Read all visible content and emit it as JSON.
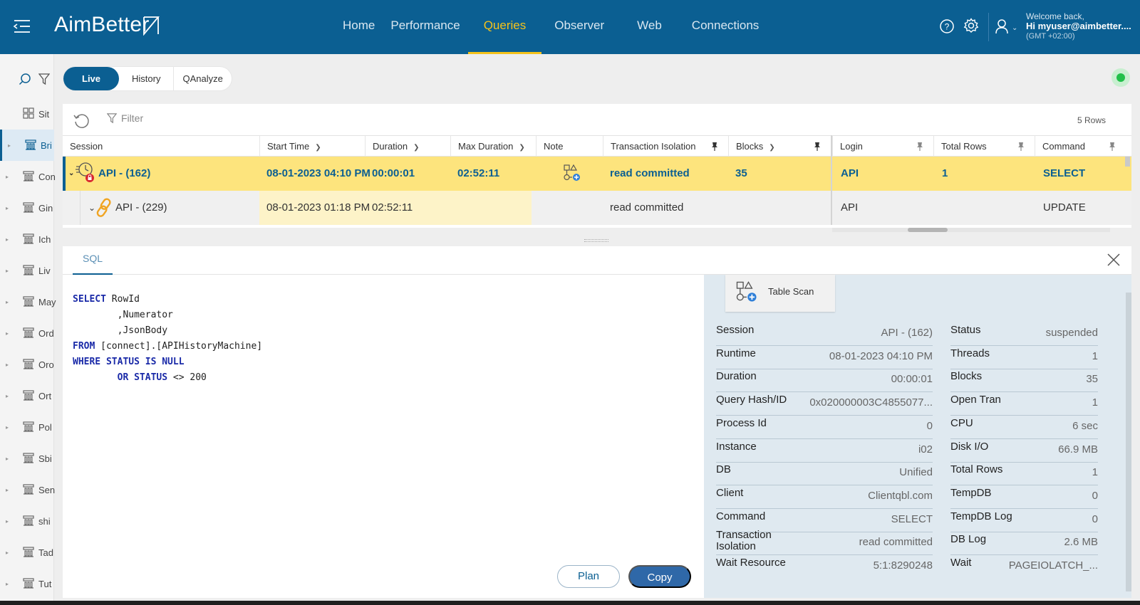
{
  "app": {
    "logo": "AimBetter"
  },
  "nav": {
    "items": [
      {
        "label": "Home"
      },
      {
        "label": "Performance"
      },
      {
        "label": "Queries",
        "active": true
      },
      {
        "label": "Observer"
      },
      {
        "label": "Web"
      },
      {
        "label": "Connections"
      }
    ]
  },
  "user": {
    "welcome": "Welcome back,",
    "hi": "Hi myuser@aimbetter....",
    "timezone": "(GMT +02:00)"
  },
  "sidebar": {
    "items": [
      {
        "label": "Sit"
      },
      {
        "label": "Bri",
        "active": true
      },
      {
        "label": "Con"
      },
      {
        "label": "Gin"
      },
      {
        "label": "Ich"
      },
      {
        "label": "Liv"
      },
      {
        "label": "May"
      },
      {
        "label": "Ord"
      },
      {
        "label": "Oro"
      },
      {
        "label": "Ort"
      },
      {
        "label": "Pol"
      },
      {
        "label": "Sbi"
      },
      {
        "label": "Sen"
      },
      {
        "label": "shi"
      },
      {
        "label": "Tad"
      },
      {
        "label": "Tut"
      }
    ]
  },
  "view_tabs": {
    "live": "Live",
    "history": "History",
    "qanalyze": "QAnalyze"
  },
  "grid": {
    "filter_label": "Filter",
    "rows_count": "5 Rows",
    "columns": {
      "session": "Session",
      "start_time": "Start Time",
      "duration": "Duration",
      "max_duration": "Max Duration",
      "note": "Note",
      "transaction_isolation": "Transaction Isolation",
      "blocks": "Blocks",
      "login": "Login",
      "total_rows": "Total Rows",
      "command": "Command"
    },
    "rows": [
      {
        "session": "API - (162)",
        "start_time": "08-01-2023 04:10 PM",
        "duration": "00:00:01",
        "max_duration": "02:52:11",
        "transaction_isolation": "read committed",
        "blocks": "35",
        "login": "API",
        "total_rows": "1",
        "command": "SELECT"
      },
      {
        "session": "API - (229)",
        "start_time": "08-01-2023 01:18 PM",
        "duration": "02:52:11",
        "max_duration": "",
        "transaction_isolation": "read committed",
        "blocks": "",
        "login": "API",
        "total_rows": "",
        "command": "UPDATE"
      }
    ]
  },
  "detail": {
    "tab_sql": "SQL",
    "sql_lines": [
      {
        "kw": "SELECT",
        "rest": " RowId"
      },
      {
        "kw": "",
        "rest": "        ,Numerator"
      },
      {
        "kw": "",
        "rest": "        ,JsonBody"
      },
      {
        "kw": "FROM",
        "rest": " [connect].[APIHistoryMachine]"
      },
      {
        "kw": "WHERE STATUS IS NULL",
        "rest": ""
      },
      {
        "kw": "        OR STATUS",
        "rest": " <> 200"
      }
    ],
    "plan_label": "Plan",
    "copy_label": "Copy",
    "table_scan_label": "Table Scan",
    "left_fields": [
      {
        "key": "Session",
        "value": "API - (162)"
      },
      {
        "key": "Runtime",
        "value": "08-01-2023 04:10 PM"
      },
      {
        "key": "Duration",
        "value": "00:00:01"
      },
      {
        "key": "Query Hash/ID",
        "value": "0x020000003C4855077..."
      },
      {
        "key": "Process Id",
        "value": "0"
      },
      {
        "key": "Instance",
        "value": "i02"
      },
      {
        "key": "DB",
        "value": "Unified"
      },
      {
        "key": "Client",
        "value": "Clientqbl.com"
      },
      {
        "key": "Command",
        "value": "SELECT"
      },
      {
        "key": "Transaction Isolation",
        "value": "read committed"
      },
      {
        "key": "Wait Resource",
        "value": "5:1:8290248"
      }
    ],
    "right_fields": [
      {
        "key": "Status",
        "value": "suspended"
      },
      {
        "key": "Threads",
        "value": "1"
      },
      {
        "key": "Blocks",
        "value": "35"
      },
      {
        "key": "Open Tran",
        "value": "1"
      },
      {
        "key": "CPU",
        "value": "6 sec"
      },
      {
        "key": "Disk I/O",
        "value": "66.9 MB"
      },
      {
        "key": "Total Rows",
        "value": "1"
      },
      {
        "key": "TempDB",
        "value": "0"
      },
      {
        "key": "TempDB Log",
        "value": "0"
      },
      {
        "key": "DB Log",
        "value": "2.6 MB"
      },
      {
        "key": "Wait",
        "value": "PAGEIOLATCH_..."
      }
    ]
  },
  "colors": {
    "brand": "#0b5f92",
    "active_nav": "#f4c21b",
    "highlight_row": "#fde47d",
    "online": "#22c04a"
  }
}
